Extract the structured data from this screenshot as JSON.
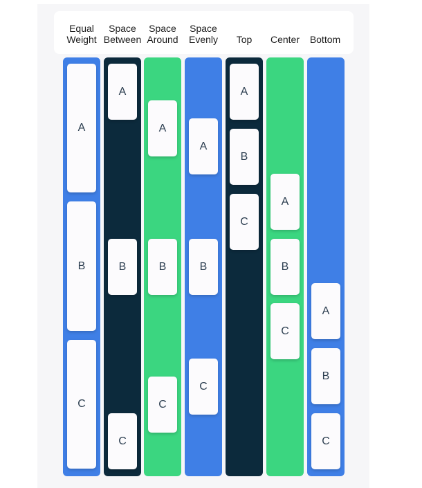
{
  "colors": {
    "blue": "#3f7fe6",
    "navy": "#0c2a3c",
    "green": "#3bd680",
    "card": "#fcfbfd",
    "card_text": "#2c3e50"
  },
  "columns": [
    {
      "id": "equal-weight",
      "label": "Equal\nWeight",
      "items": [
        "A",
        "B",
        "C"
      ]
    },
    {
      "id": "space-between",
      "label": "Space\nBetween",
      "items": [
        "A",
        "B",
        "C"
      ]
    },
    {
      "id": "space-around",
      "label": "Space\nAround",
      "items": [
        "A",
        "B",
        "C"
      ]
    },
    {
      "id": "space-evenly",
      "label": "Space\nEvenly",
      "items": [
        "A",
        "B",
        "C"
      ]
    },
    {
      "id": "top",
      "label": "Top",
      "items": [
        "A",
        "B",
        "C"
      ]
    },
    {
      "id": "center",
      "label": "Center",
      "items": [
        "A",
        "B",
        "C"
      ]
    },
    {
      "id": "bottom",
      "label": "Bottom",
      "items": [
        "A",
        "B",
        "C"
      ]
    }
  ]
}
